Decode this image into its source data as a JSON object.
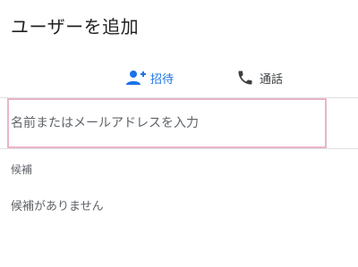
{
  "dialog": {
    "title": "ユーザーを追加"
  },
  "tabs": [
    {
      "label": "招待",
      "icon": "person-add-icon",
      "color": "#1a73e8",
      "active": true
    },
    {
      "label": "通話",
      "icon": "phone-icon",
      "color": "#3c4043",
      "active": false
    }
  ],
  "search": {
    "placeholder": "名前またはメールアドレスを入力",
    "value": ""
  },
  "suggestions": {
    "label": "候補",
    "empty_text": "候補がありません"
  },
  "colors": {
    "accent": "#1a73e8",
    "focus_border": "#e8b4cb",
    "text_primary": "#202124",
    "text_secondary": "#5f6368"
  }
}
